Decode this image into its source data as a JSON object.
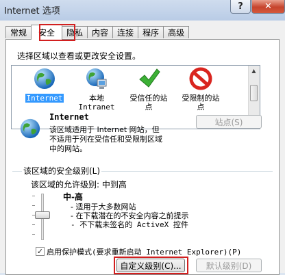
{
  "window": {
    "title": "Internet 选项",
    "help_label": "?",
    "close_label": "✕"
  },
  "tabs": [
    {
      "label": "常规"
    },
    {
      "label": "安全",
      "active": true
    },
    {
      "label": "隐私"
    },
    {
      "label": "内容"
    },
    {
      "label": "连接"
    },
    {
      "label": "程序"
    },
    {
      "label": "高级"
    }
  ],
  "security": {
    "prompt": "选择区域以查看或更改安全设置。",
    "zones": [
      {
        "icon": "globe-icon",
        "label": "Internet",
        "selected": true
      },
      {
        "icon": "local-intranet-icon",
        "label": "本地\nIntranet"
      },
      {
        "icon": "checkmark-icon",
        "label": "受信任的站\n点"
      },
      {
        "icon": "no-entry-icon",
        "label": "受限制的站\n点"
      }
    ],
    "selected_zone": {
      "name": "Internet",
      "description": "该区域适用于 Internet 网站，但\n不适用于列在受信任和受限制区域\n中的网站。",
      "sites_button": "站点(S)"
    },
    "level_group": {
      "title": "该区域的安全级别(L)",
      "allowed_levels": "该区域的允许级别: 中到高",
      "level_name": "中-高",
      "level_bullets": [
        "- 适用于大多数网站",
        "- 在下载潜在的不安全内容之前提示",
        "- 不下载未签名的 ActiveX 控件"
      ]
    },
    "protected_mode": {
      "label": "启用保护模式(要求重新启动 Internet Explorer)(P)",
      "checked": true
    },
    "custom_level_button": "自定义级别(C)...",
    "default_level_button": "默认级别(D)"
  },
  "colors": {
    "highlight_box": "#d21f1f",
    "selection": "#3399ff"
  }
}
